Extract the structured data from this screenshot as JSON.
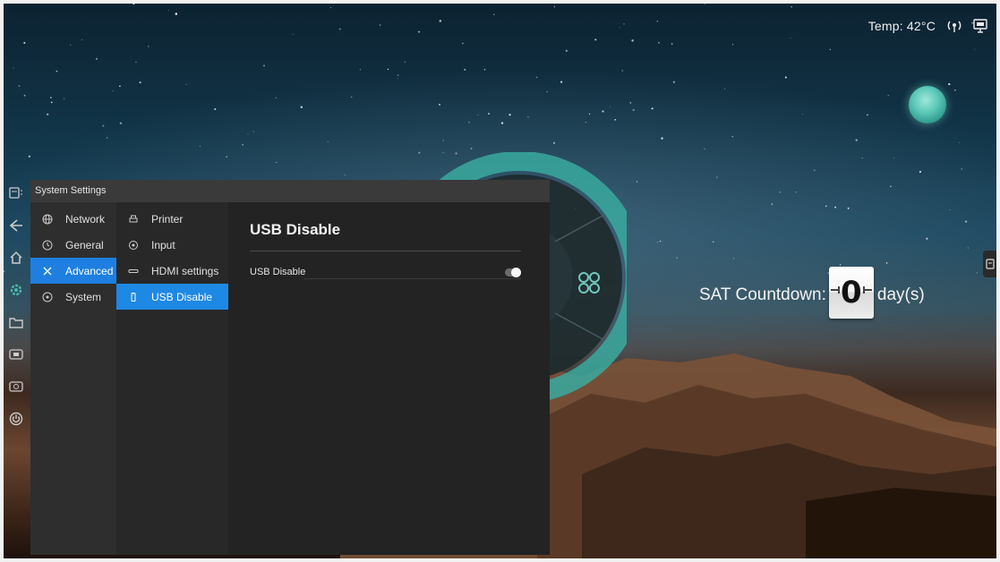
{
  "status_bar": {
    "temperature": "Temp: 42°C",
    "icons": [
      "wifi-hotspot-icon",
      "display-signal-icon"
    ]
  },
  "countdown": {
    "label": "SAT Countdown:",
    "value": "0",
    "unit": "day(s)"
  },
  "dock": {
    "items": [
      "screen-menu-icon",
      "back-icon",
      "home-icon",
      "settings-gear-icon",
      "folder-icon",
      "source-icon",
      "camera-icon",
      "power-icon"
    ]
  },
  "settings": {
    "window_title": "System Settings",
    "categories": [
      {
        "label": "Network",
        "icon": "globe-icon"
      },
      {
        "label": "General",
        "icon": "clock-icon"
      },
      {
        "label": "Advanced",
        "icon": "tools-icon"
      },
      {
        "label": "System",
        "icon": "info-circle-icon"
      }
    ],
    "active_category": "Advanced",
    "subcategories": [
      {
        "label": "Printer",
        "icon": "printer-icon"
      },
      {
        "label": "Input",
        "icon": "input-icon"
      },
      {
        "label": "HDMI settings",
        "icon": "hdmi-icon"
      },
      {
        "label": "USB Disable",
        "icon": "usb-icon"
      }
    ],
    "active_subcategory": "USB Disable",
    "detail": {
      "title": "USB Disable",
      "rows": [
        {
          "label": "USB Disable",
          "enabled": false
        }
      ]
    }
  },
  "colors": {
    "accent": "#1e88e5",
    "panel_bg": "#252525",
    "dial_teal": "#3aa99f"
  }
}
